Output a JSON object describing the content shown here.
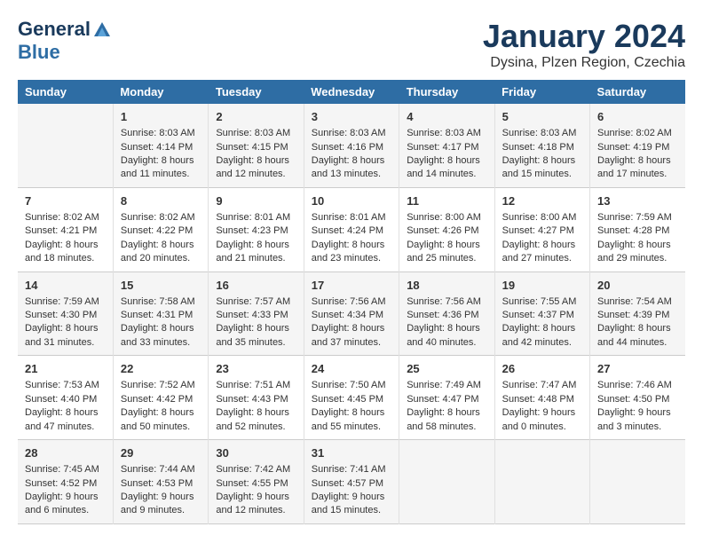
{
  "logo": {
    "line1": "General",
    "line2": "Blue"
  },
  "title": "January 2024",
  "subtitle": "Dysina, Plzen Region, Czechia",
  "headers": [
    "Sunday",
    "Monday",
    "Tuesday",
    "Wednesday",
    "Thursday",
    "Friday",
    "Saturday"
  ],
  "weeks": [
    [
      {
        "day": "",
        "sunrise": "",
        "sunset": "",
        "daylight": ""
      },
      {
        "day": "1",
        "sunrise": "Sunrise: 8:03 AM",
        "sunset": "Sunset: 4:14 PM",
        "daylight": "Daylight: 8 hours and 11 minutes."
      },
      {
        "day": "2",
        "sunrise": "Sunrise: 8:03 AM",
        "sunset": "Sunset: 4:15 PM",
        "daylight": "Daylight: 8 hours and 12 minutes."
      },
      {
        "day": "3",
        "sunrise": "Sunrise: 8:03 AM",
        "sunset": "Sunset: 4:16 PM",
        "daylight": "Daylight: 8 hours and 13 minutes."
      },
      {
        "day": "4",
        "sunrise": "Sunrise: 8:03 AM",
        "sunset": "Sunset: 4:17 PM",
        "daylight": "Daylight: 8 hours and 14 minutes."
      },
      {
        "day": "5",
        "sunrise": "Sunrise: 8:03 AM",
        "sunset": "Sunset: 4:18 PM",
        "daylight": "Daylight: 8 hours and 15 minutes."
      },
      {
        "day": "6",
        "sunrise": "Sunrise: 8:02 AM",
        "sunset": "Sunset: 4:19 PM",
        "daylight": "Daylight: 8 hours and 17 minutes."
      }
    ],
    [
      {
        "day": "7",
        "sunrise": "Sunrise: 8:02 AM",
        "sunset": "Sunset: 4:21 PM",
        "daylight": "Daylight: 8 hours and 18 minutes."
      },
      {
        "day": "8",
        "sunrise": "Sunrise: 8:02 AM",
        "sunset": "Sunset: 4:22 PM",
        "daylight": "Daylight: 8 hours and 20 minutes."
      },
      {
        "day": "9",
        "sunrise": "Sunrise: 8:01 AM",
        "sunset": "Sunset: 4:23 PM",
        "daylight": "Daylight: 8 hours and 21 minutes."
      },
      {
        "day": "10",
        "sunrise": "Sunrise: 8:01 AM",
        "sunset": "Sunset: 4:24 PM",
        "daylight": "Daylight: 8 hours and 23 minutes."
      },
      {
        "day": "11",
        "sunrise": "Sunrise: 8:00 AM",
        "sunset": "Sunset: 4:26 PM",
        "daylight": "Daylight: 8 hours and 25 minutes."
      },
      {
        "day": "12",
        "sunrise": "Sunrise: 8:00 AM",
        "sunset": "Sunset: 4:27 PM",
        "daylight": "Daylight: 8 hours and 27 minutes."
      },
      {
        "day": "13",
        "sunrise": "Sunrise: 7:59 AM",
        "sunset": "Sunset: 4:28 PM",
        "daylight": "Daylight: 8 hours and 29 minutes."
      }
    ],
    [
      {
        "day": "14",
        "sunrise": "Sunrise: 7:59 AM",
        "sunset": "Sunset: 4:30 PM",
        "daylight": "Daylight: 8 hours and 31 minutes."
      },
      {
        "day": "15",
        "sunrise": "Sunrise: 7:58 AM",
        "sunset": "Sunset: 4:31 PM",
        "daylight": "Daylight: 8 hours and 33 minutes."
      },
      {
        "day": "16",
        "sunrise": "Sunrise: 7:57 AM",
        "sunset": "Sunset: 4:33 PM",
        "daylight": "Daylight: 8 hours and 35 minutes."
      },
      {
        "day": "17",
        "sunrise": "Sunrise: 7:56 AM",
        "sunset": "Sunset: 4:34 PM",
        "daylight": "Daylight: 8 hours and 37 minutes."
      },
      {
        "day": "18",
        "sunrise": "Sunrise: 7:56 AM",
        "sunset": "Sunset: 4:36 PM",
        "daylight": "Daylight: 8 hours and 40 minutes."
      },
      {
        "day": "19",
        "sunrise": "Sunrise: 7:55 AM",
        "sunset": "Sunset: 4:37 PM",
        "daylight": "Daylight: 8 hours and 42 minutes."
      },
      {
        "day": "20",
        "sunrise": "Sunrise: 7:54 AM",
        "sunset": "Sunset: 4:39 PM",
        "daylight": "Daylight: 8 hours and 44 minutes."
      }
    ],
    [
      {
        "day": "21",
        "sunrise": "Sunrise: 7:53 AM",
        "sunset": "Sunset: 4:40 PM",
        "daylight": "Daylight: 8 hours and 47 minutes."
      },
      {
        "day": "22",
        "sunrise": "Sunrise: 7:52 AM",
        "sunset": "Sunset: 4:42 PM",
        "daylight": "Daylight: 8 hours and 50 minutes."
      },
      {
        "day": "23",
        "sunrise": "Sunrise: 7:51 AM",
        "sunset": "Sunset: 4:43 PM",
        "daylight": "Daylight: 8 hours and 52 minutes."
      },
      {
        "day": "24",
        "sunrise": "Sunrise: 7:50 AM",
        "sunset": "Sunset: 4:45 PM",
        "daylight": "Daylight: 8 hours and 55 minutes."
      },
      {
        "day": "25",
        "sunrise": "Sunrise: 7:49 AM",
        "sunset": "Sunset: 4:47 PM",
        "daylight": "Daylight: 8 hours and 58 minutes."
      },
      {
        "day": "26",
        "sunrise": "Sunrise: 7:47 AM",
        "sunset": "Sunset: 4:48 PM",
        "daylight": "Daylight: 9 hours and 0 minutes."
      },
      {
        "day": "27",
        "sunrise": "Sunrise: 7:46 AM",
        "sunset": "Sunset: 4:50 PM",
        "daylight": "Daylight: 9 hours and 3 minutes."
      }
    ],
    [
      {
        "day": "28",
        "sunrise": "Sunrise: 7:45 AM",
        "sunset": "Sunset: 4:52 PM",
        "daylight": "Daylight: 9 hours and 6 minutes."
      },
      {
        "day": "29",
        "sunrise": "Sunrise: 7:44 AM",
        "sunset": "Sunset: 4:53 PM",
        "daylight": "Daylight: 9 hours and 9 minutes."
      },
      {
        "day": "30",
        "sunrise": "Sunrise: 7:42 AM",
        "sunset": "Sunset: 4:55 PM",
        "daylight": "Daylight: 9 hours and 12 minutes."
      },
      {
        "day": "31",
        "sunrise": "Sunrise: 7:41 AM",
        "sunset": "Sunset: 4:57 PM",
        "daylight": "Daylight: 9 hours and 15 minutes."
      },
      {
        "day": "",
        "sunrise": "",
        "sunset": "",
        "daylight": ""
      },
      {
        "day": "",
        "sunrise": "",
        "sunset": "",
        "daylight": ""
      },
      {
        "day": "",
        "sunrise": "",
        "sunset": "",
        "daylight": ""
      }
    ]
  ]
}
